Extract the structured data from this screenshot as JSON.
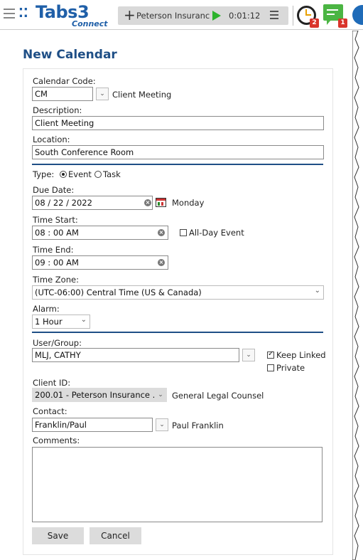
{
  "header": {
    "logo_text": "Tabs3",
    "logo_sub": "Connect",
    "timer_client": "Peterson Insuranc",
    "timer_time": "0:01:12",
    "alarm_badge": "2",
    "chat_badge": "1"
  },
  "page": {
    "title": "New Calendar"
  },
  "form": {
    "calendar_code_label": "Calendar Code:",
    "calendar_code": "CM",
    "calendar_code_desc": "Client Meeting",
    "description_label": "Description:",
    "description": "Client Meeting",
    "location_label": "Location:",
    "location": "South Conference Room",
    "type_label": "Type:",
    "type_event": "Event",
    "type_task": "Task",
    "type_selected": "Event",
    "due_date_label": "Due Date:",
    "due_date": "08 / 22 / 2022",
    "due_day": "Monday",
    "time_start_label": "Time Start:",
    "time_start": "08 : 00  AM",
    "all_day_label": "All-Day Event",
    "all_day_checked": false,
    "time_end_label": "Time End:",
    "time_end": "09 : 00  AM",
    "time_zone_label": "Time Zone:",
    "time_zone": "(UTC-06:00) Central Time (US & Canada)",
    "alarm_label": "Alarm:",
    "alarm": "1 Hour",
    "user_group_label": "User/Group:",
    "user_group": "MLJ, CATHY",
    "keep_linked_label": "Keep Linked",
    "keep_linked_checked": true,
    "private_label": "Private",
    "private_checked": false,
    "client_id_label": "Client ID:",
    "client_id": "200.01 - Peterson Insurance ...",
    "client_desc": "General Legal Counsel",
    "contact_label": "Contact:",
    "contact": "Franklin/Paul",
    "contact_desc": "Paul Franklin",
    "comments_label": "Comments:",
    "comments": "",
    "save_label": "Save",
    "cancel_label": "Cancel"
  },
  "colors": {
    "brand": "#1f5fa8",
    "title": "#1f4f86",
    "play": "#2db32d",
    "badge": "#d9342b",
    "chat": "#4bb543"
  }
}
